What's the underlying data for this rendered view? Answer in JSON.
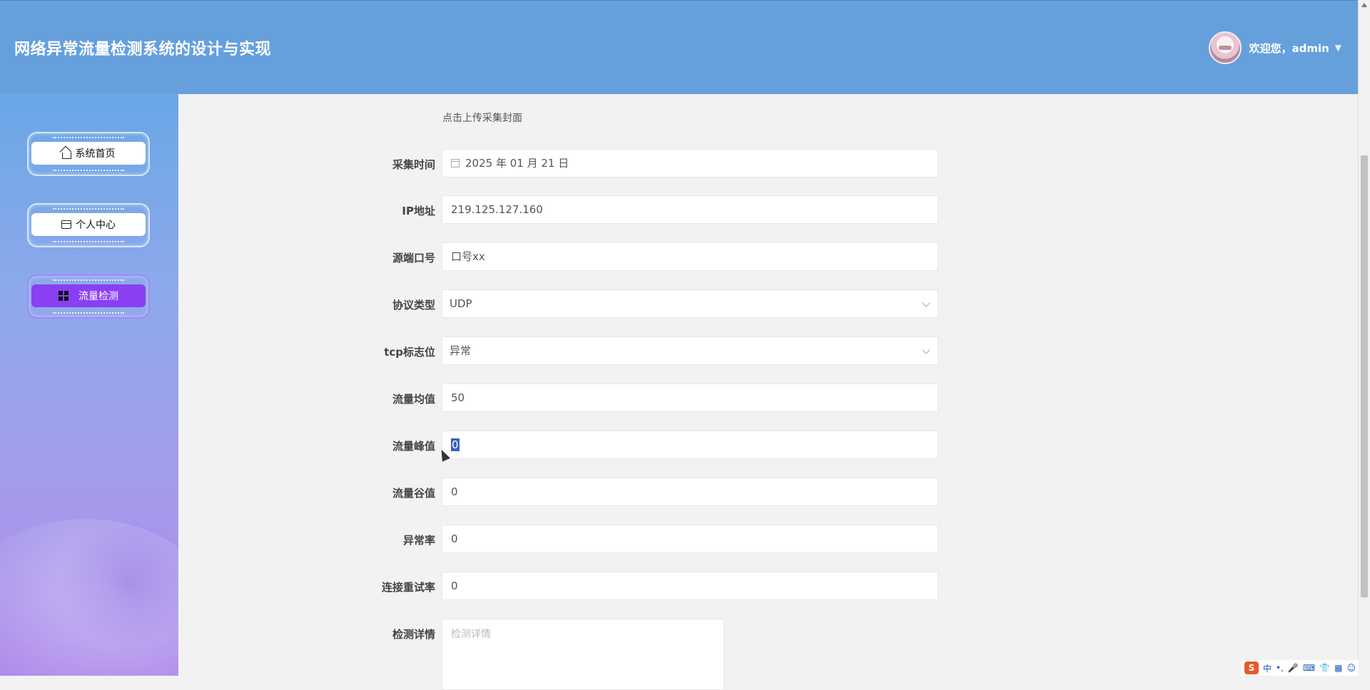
{
  "header": {
    "title": "网络异常流量检测系统的设计与实现",
    "welcome": "欢迎您，admin"
  },
  "sidebar": {
    "items": [
      {
        "label": "系统首页",
        "icon": "home-icon"
      },
      {
        "label": "个人中心",
        "icon": "wallet-icon"
      },
      {
        "label": "流量检测",
        "icon": "grid-icon",
        "active": true
      }
    ]
  },
  "form": {
    "upload_hint": "点击上传采集封面",
    "fields": [
      {
        "label": "采集时间",
        "value": "2025 年 01 月 21 日",
        "type": "date"
      },
      {
        "label": "IP地址",
        "value": "219.125.127.160"
      },
      {
        "label": "源端口号",
        "value": "口号xx"
      },
      {
        "label": "协议类型",
        "value": "UDP",
        "type": "select"
      },
      {
        "label": "tcp标志位",
        "value": "异常",
        "type": "select"
      },
      {
        "label": "流量均值",
        "value": "50"
      },
      {
        "label": "流量峰值",
        "value": "0",
        "selected": true
      },
      {
        "label": "流量谷值",
        "value": "0"
      },
      {
        "label": "异常率",
        "value": "0"
      },
      {
        "label": "连接重试率",
        "value": "0"
      },
      {
        "label": "检测详情",
        "placeholder": "检测详情"
      }
    ]
  },
  "ime": {
    "logo": "S",
    "lang": "中",
    "symbols": [
      "•,",
      "🎤",
      "⌨",
      "👕",
      "▦",
      "☺"
    ]
  },
  "colors": {
    "header_bg": "#65a0dd",
    "active_nav": "#8a3ff2"
  }
}
